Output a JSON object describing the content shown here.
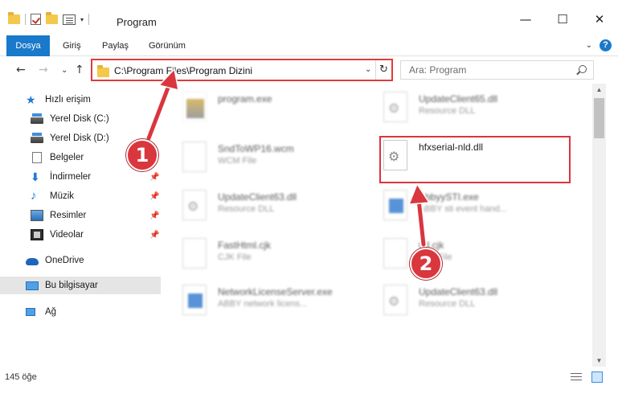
{
  "window": {
    "title": "Program",
    "controls": {
      "minimize": "—",
      "maximize": "☐",
      "close": "✕"
    }
  },
  "ribbon": {
    "tabs": [
      "Dosya",
      "Giriş",
      "Paylaş",
      "Görünüm"
    ],
    "help": "?",
    "expand": "⌄"
  },
  "navigation": {
    "back": "←",
    "forward": "→",
    "recent": "⌄",
    "up": "↑",
    "address": "C:\\Program Files\\Program Dizini",
    "address_dropdown": "⌄",
    "refresh": "↻",
    "search_placeholder": "Ara: Program"
  },
  "sidebar": {
    "items": [
      {
        "label": "Hızlı erişim",
        "icon": "star-icon"
      },
      {
        "label": "Yerel Disk (C:)",
        "icon": "drive-icon"
      },
      {
        "label": "Yerel Disk (D:)",
        "icon": "drive-icon"
      },
      {
        "label": "Belgeler",
        "icon": "documents-icon"
      },
      {
        "label": "İndirmeler",
        "icon": "downloads-icon"
      },
      {
        "label": "Müzik",
        "icon": "music-icon"
      },
      {
        "label": "Resimler",
        "icon": "pictures-icon"
      },
      {
        "label": "Videolar",
        "icon": "videos-icon"
      },
      {
        "label": "OneDrive",
        "icon": "cloud-icon"
      },
      {
        "label": "Bu bilgisayar",
        "icon": "computer-icon"
      },
      {
        "label": "Ağ",
        "icon": "network-icon"
      }
    ],
    "pin": "📌"
  },
  "files": [
    {
      "name": "program.exe",
      "type": ""
    },
    {
      "name": "UpdateClient65.dll",
      "type": "Resource DLL"
    },
    {
      "name": "SndToWP16.wcm",
      "type": "WCM File"
    },
    {
      "name": "hfxserial-nld.dll",
      "type": ""
    },
    {
      "name": "UpdateClient63.dll",
      "type": "Resource DLL"
    },
    {
      "name": "AbbyySTI.exe",
      "type": "ABBY sti event hand..."
    },
    {
      "name": "FastHtml.cjk",
      "type": "CJK File"
    },
    {
      "name": "ttd.cjk",
      "type": "CJK File"
    },
    {
      "name": "NetworkLicenseServer.exe",
      "type": "ABBY network licens..."
    },
    {
      "name": "UpdateClient63.dll",
      "type": "Resource DLL"
    }
  ],
  "status": {
    "item_count": "145 öğe"
  },
  "callouts": [
    "1",
    "2"
  ],
  "colors": {
    "accent": "#1979ca",
    "annotation": "#d9363e",
    "folder": "#f4c84a"
  }
}
